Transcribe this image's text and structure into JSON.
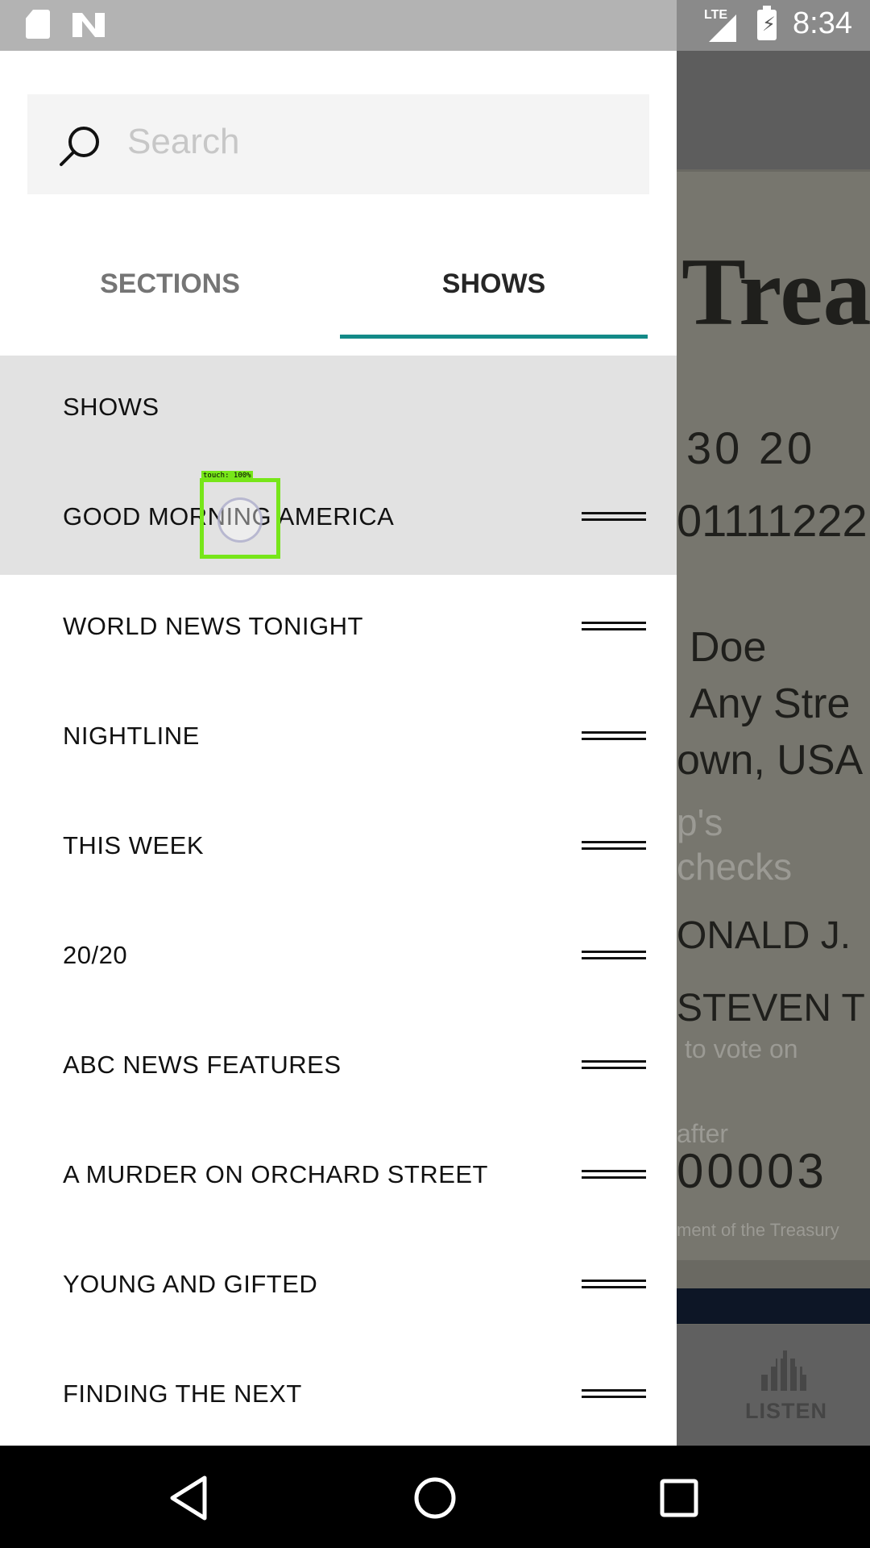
{
  "status_bar": {
    "network": "LTE",
    "time": "8:34",
    "icons": [
      "sd-card-icon",
      "n-notification-icon",
      "signal-icon",
      "battery-charging-icon"
    ]
  },
  "drawer": {
    "search": {
      "placeholder": "Search"
    },
    "tabs": [
      {
        "label": "SECTIONS",
        "selected": false
      },
      {
        "label": "SHOWS",
        "selected": true
      }
    ],
    "list_header": "SHOWS",
    "items": [
      {
        "label": "GOOD MORNING AMERICA",
        "pressed": true
      },
      {
        "label": "WORLD NEWS TONIGHT"
      },
      {
        "label": "NIGHTLINE"
      },
      {
        "label": "THIS WEEK"
      },
      {
        "label": "20/20"
      },
      {
        "label": "ABC NEWS FEATURES"
      },
      {
        "label": "A MURDER ON ORCHARD STREET"
      },
      {
        "label": "YOUNG AND GIFTED"
      },
      {
        "label": "FINDING THE NEXT"
      }
    ],
    "accent_color": "#138a88"
  },
  "background_app": {
    "fragments": [
      "Treas",
      "30  20",
      "01111222",
      "Doe",
      "Any Stre",
      "own, USA",
      "p's",
      "checks",
      "ONALD J.",
      "STEVEN T",
      "to vote on",
      "after",
      "00003",
      "ment of the Treasury"
    ],
    "tab_label": "LISTEN"
  },
  "touch_overlay": {
    "label": "touch: 100%"
  },
  "nav_bar": {
    "buttons": [
      "back",
      "home",
      "recents"
    ]
  }
}
